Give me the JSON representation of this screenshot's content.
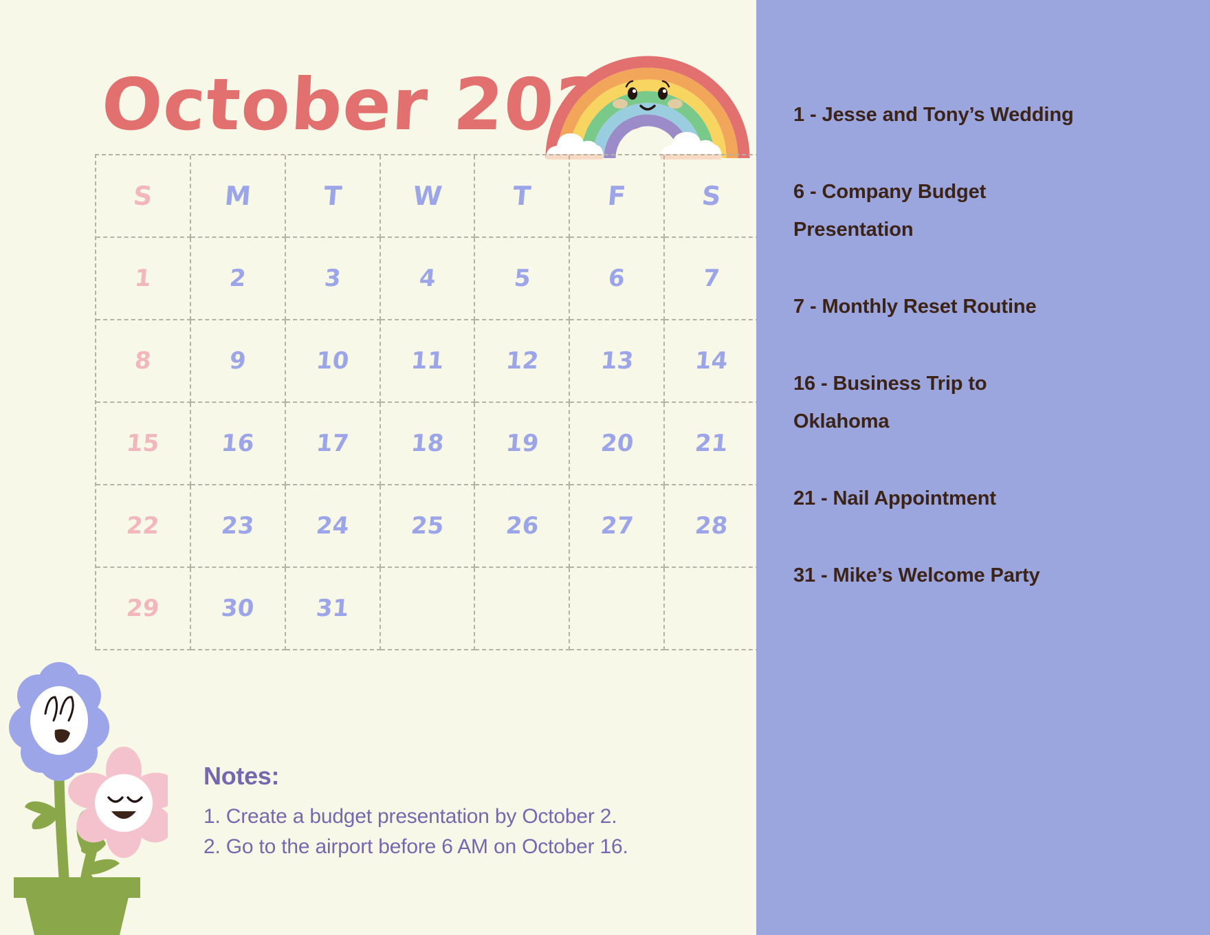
{
  "header": {
    "month_title": "October 2023",
    "title_color": "#E2706F",
    "rainbow_icon": "rainbow-with-face-icon",
    "rainbow_bands": [
      "#E2706F",
      "#F2A65A",
      "#F7D560",
      "#79C98A",
      "#9BCDE0",
      "#9B8BC9"
    ]
  },
  "calendar": {
    "weekdays": [
      "S",
      "M",
      "T",
      "W",
      "T",
      "F",
      "S"
    ],
    "weekday_colors": {
      "sunday": "#F2B7BD",
      "weekday": "#9BA5E8"
    },
    "grid_line_color": "#B4B2A6",
    "weeks": [
      [
        "1",
        "2",
        "3",
        "4",
        "5",
        "6",
        "7"
      ],
      [
        "8",
        "9",
        "10",
        "11",
        "12",
        "13",
        "14"
      ],
      [
        "15",
        "16",
        "17",
        "18",
        "19",
        "20",
        "21"
      ],
      [
        "22",
        "23",
        "24",
        "25",
        "26",
        "27",
        "28"
      ],
      [
        "29",
        "30",
        "31",
        "",
        "",
        "",
        ""
      ]
    ]
  },
  "notes": {
    "title": "Notes:",
    "color": "#7468AE",
    "items": [
      "1. Create a budget presentation by October 2.",
      "2. Go to the airport before 6 AM on October 16."
    ]
  },
  "decoration": {
    "flower_pot_icon": "potted-flowers-icon",
    "pot_color": "#8AA84A",
    "stem_color": "#8AA84A",
    "blue_flower_color": "#9BA5E8",
    "pink_flower_color": "#F4C2CC"
  },
  "events_panel": {
    "background": "#9BA5DE",
    "text_color": "#3B2317",
    "events": [
      "1 - Jesse and Tony’s Wedding",
      "6 - Company Budget Presentation",
      "7 - Monthly Reset Routine",
      "16 - Business Trip to Oklahoma",
      "21 - Nail Appointment",
      "31 - Mike’s Welcome Party"
    ]
  }
}
